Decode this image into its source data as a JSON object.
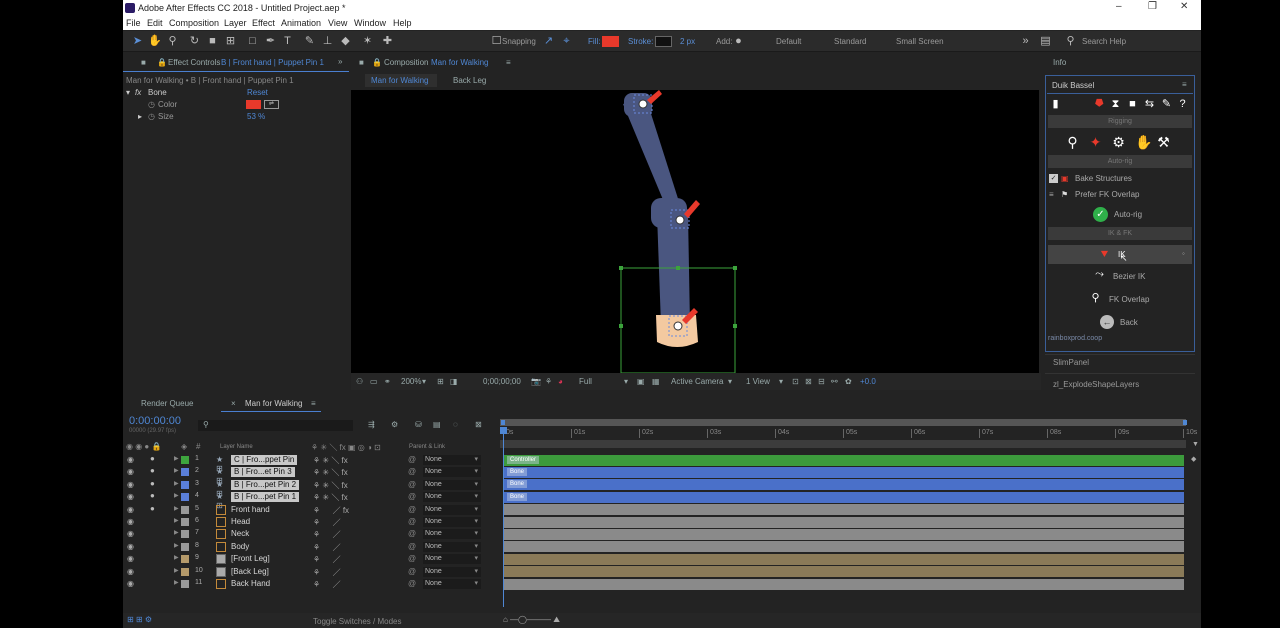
{
  "app": {
    "title": "Adobe After Effects CC 2018 - Untitled Project.aep *",
    "window_controls": [
      "–",
      "❐",
      "✕"
    ]
  },
  "menu": [
    "File",
    "Edit",
    "Composition",
    "Layer",
    "Effect",
    "Animation",
    "View",
    "Window",
    "Help"
  ],
  "toolbar": {
    "snapping_label": "Snapping",
    "fill_label": "Fill:",
    "stroke_label": "Stroke:",
    "stroke_width": "2 px",
    "add_label": "Add:",
    "workspaces": [
      "Default",
      "Standard",
      "Small Screen"
    ],
    "search_label": "Search Help",
    "fill_color": "#e8392b",
    "stroke_color": "#111111"
  },
  "effect_controls": {
    "tab_label": "Effect Controls",
    "tab_target": "B | Front hand | Puppet Pin 1",
    "breadcrumb": "Man for Walking • B | Front hand | Puppet Pin 1",
    "effect_name": "Bone",
    "reset_label": "Reset",
    "color_label": "Color",
    "size_label": "Size",
    "size_value": "53 %",
    "bone_color": "#e8392b"
  },
  "composition": {
    "panel_label": "Composition",
    "comp_name": "Man for Walking",
    "crumbs": [
      "Man for Walking",
      "Back Leg"
    ],
    "bottom": {
      "zoom": "200%",
      "timecode": "0;00;00;00",
      "resolution": "Full",
      "camera": "Active Camera",
      "views": "1 View",
      "exposure": "+0.0"
    },
    "arm_color": "#4a5680",
    "hand_color": "#f3c9a0"
  },
  "duik": {
    "title": "Duik Bassel",
    "info_label": "Info",
    "sections": {
      "rigging": "Rigging",
      "autorig": "Auto-rig",
      "ikfk": "IK & FK"
    },
    "options": [
      "Bake Structures",
      "Prefer FK Overlap"
    ],
    "autorig_button": "Auto-rig",
    "ik_label": "IK",
    "bezier_label": "Bezier IK",
    "fkoverlap_label": "FK Overlap",
    "back_label": "Back",
    "footer": "rainboxprod.coop",
    "other_panels": [
      "SlimPanel",
      "zl_ExplodeShapeLayers"
    ]
  },
  "timeline": {
    "tabs": [
      "Render Queue",
      "Man for Walking"
    ],
    "timecode": "0:00:00:00",
    "fps": "00000 (29.97 fps)",
    "col_layer_name": "Layer Name",
    "col_parent": "Parent & Link",
    "ruler": [
      "0s",
      "01s",
      "02s",
      "03s",
      "04s",
      "05s",
      "06s",
      "07s",
      "08s",
      "09s",
      "10s"
    ],
    "footer": "Toggle Switches / Modes",
    "layers": [
      {
        "num": "1",
        "name": "C | Fro...ppet Pin",
        "parent": "None",
        "label": "#3ea53e",
        "bar": "#3c9b3c",
        "bar_label": "Controller"
      },
      {
        "num": "2",
        "name": "B | Fro...et Pin 3",
        "parent": "None",
        "label": "#5a7fd9",
        "bar": "#4a70c9",
        "bar_label": "Bone"
      },
      {
        "num": "3",
        "name": "B | Fro...pet Pin 2",
        "parent": "None",
        "label": "#5a7fd9",
        "bar": "#4a70c9",
        "bar_label": "Bone"
      },
      {
        "num": "4",
        "name": "B | Fro...pet Pin 1",
        "parent": "None",
        "label": "#5a7fd9",
        "bar": "#4a70c9",
        "bar_label": "Bone"
      },
      {
        "num": "5",
        "name": "Front hand",
        "parent": "None",
        "label": "#9a9a9a",
        "bar": "#8a8a8a",
        "bar_label": ""
      },
      {
        "num": "6",
        "name": "Head",
        "parent": "None",
        "label": "#9a9a9a",
        "bar": "#8a8a8a",
        "bar_label": ""
      },
      {
        "num": "7",
        "name": "Neck",
        "parent": "None",
        "label": "#9a9a9a",
        "bar": "#8a8a8a",
        "bar_label": ""
      },
      {
        "num": "8",
        "name": "Body",
        "parent": "None",
        "label": "#9a9a9a",
        "bar": "#8a8a8a",
        "bar_label": ""
      },
      {
        "num": "9",
        "name": "[Front Leg]",
        "parent": "None",
        "label": "#b59a6a",
        "bar": "#8a7a58",
        "bar_label": ""
      },
      {
        "num": "10",
        "name": "[Back Leg]",
        "parent": "None",
        "label": "#b59a6a",
        "bar": "#8a7a58",
        "bar_label": ""
      },
      {
        "num": "11",
        "name": "Back Hand",
        "parent": "None",
        "label": "#9a9a9a",
        "bar": "#8a8a8a",
        "bar_label": ""
      }
    ]
  }
}
